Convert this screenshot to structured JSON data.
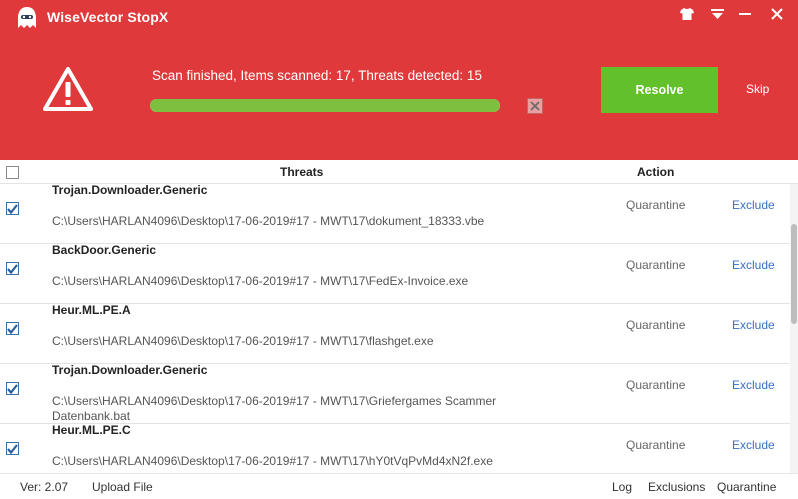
{
  "app": {
    "title": "WiseVector StopX"
  },
  "header": {
    "status_text": "Scan finished, Items scanned: 17, Threats detected: 15",
    "progress_percent": 100,
    "resolve_label": "Resolve",
    "skip_label": "Skip"
  },
  "colors": {
    "header_bg": "#e0393b",
    "resolve_green": "#62c12a",
    "progress_green": "#7fbf3f",
    "link_blue": "#3a6fc4"
  },
  "table": {
    "col_threats": "Threats",
    "col_action": "Action",
    "rows": [
      {
        "name": "Trojan.Downloader.Generic",
        "path": "C:\\Users\\HARLAN4096\\Desktop\\17-06-2019#17 - MWT\\17\\dokument_18333.vbe",
        "action": "Quarantine",
        "exclude": "Exclude",
        "checked": true
      },
      {
        "name": "BackDoor.Generic",
        "path": "C:\\Users\\HARLAN4096\\Desktop\\17-06-2019#17 - MWT\\17\\FedEx-Invoice.exe",
        "action": "Quarantine",
        "exclude": "Exclude",
        "checked": true
      },
      {
        "name": "Heur.ML.PE.A",
        "path": "C:\\Users\\HARLAN4096\\Desktop\\17-06-2019#17 - MWT\\17\\flashget.exe",
        "action": "Quarantine",
        "exclude": "Exclude",
        "checked": true
      },
      {
        "name": "Trojan.Downloader.Generic",
        "path": "C:\\Users\\HARLAN4096\\Desktop\\17-06-2019#17 - MWT\\17\\Griefergames Scammer Datenbank.bat",
        "action": "Quarantine",
        "exclude": "Exclude",
        "checked": true
      },
      {
        "name": "Heur.ML.PE.C",
        "path": "C:\\Users\\HARLAN4096\\Desktop\\17-06-2019#17 - MWT\\17\\hY0tVqPvMd4xN2f.exe",
        "action": "Quarantine",
        "exclude": "Exclude",
        "checked": true
      }
    ]
  },
  "footer": {
    "version": "Ver: 2.07",
    "upload_file": "Upload File",
    "log": "Log",
    "exclusions": "Exclusions",
    "quarantine": "Quarantine"
  },
  "icons": {
    "logo": "stopx-ghost-logo",
    "theme": "tshirt-icon",
    "menu": "menu-icon",
    "minimize": "minimize-icon",
    "close": "close-icon",
    "warning": "warning-triangle-icon",
    "cancel": "cancel-x-icon"
  }
}
